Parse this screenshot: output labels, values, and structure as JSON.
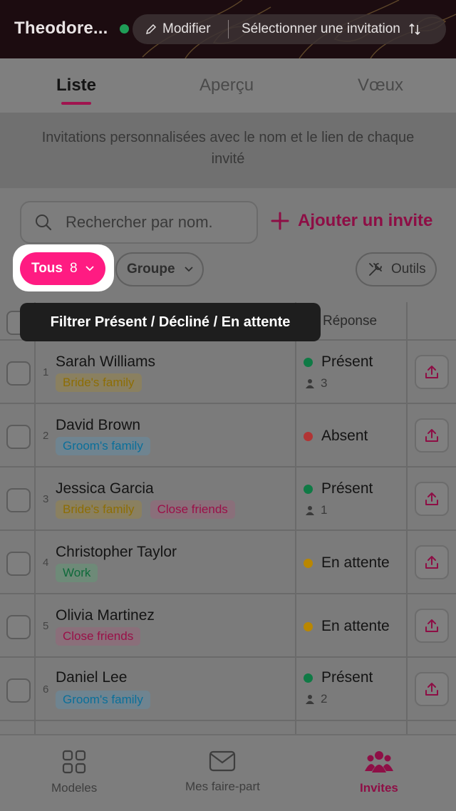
{
  "header": {
    "title": "Theodore...",
    "edit_label": "Modifier",
    "select_label": "Sélectionner une invitation"
  },
  "tabs": [
    {
      "label": "Liste",
      "active": true
    },
    {
      "label": "Aperçu",
      "active": false
    },
    {
      "label": "Vœux",
      "active": false
    }
  ],
  "info_text": "Invitations personnalisées avec le nom et le lien de chaque invité",
  "toolbar": {
    "search_placeholder": "Rechercher par nom.",
    "add_label": "Ajouter un invite",
    "filter_label": "Tous",
    "filter_count": "8",
    "group_label": "Groupe",
    "tools_label": "Outils"
  },
  "tooltip": "Filtrer Présent / Décliné / En attente",
  "table": {
    "header_response": "Réponse",
    "rows": [
      {
        "num": "1",
        "name": "Sarah Williams",
        "tags": [
          "Bride's family"
        ],
        "status": "Présent",
        "guests": "3"
      },
      {
        "num": "2",
        "name": "David Brown",
        "tags": [
          "Groom's family"
        ],
        "status": "Absent",
        "guests": ""
      },
      {
        "num": "3",
        "name": "Jessica Garcia",
        "tags": [
          "Bride's family",
          "Close friends"
        ],
        "status": "Présent",
        "guests": "1"
      },
      {
        "num": "4",
        "name": "Christopher Taylor",
        "tags": [
          "Work"
        ],
        "status": "En attente",
        "guests": ""
      },
      {
        "num": "5",
        "name": "Olivia Martinez",
        "tags": [
          "Close friends"
        ],
        "status": "En attente",
        "guests": ""
      },
      {
        "num": "6",
        "name": "Daniel Lee",
        "tags": [
          "Groom's family"
        ],
        "status": "Présent",
        "guests": "2"
      }
    ]
  },
  "bottom_nav": [
    {
      "label": "Modeles",
      "active": false
    },
    {
      "label": "Mes faire-part",
      "active": false
    },
    {
      "label": "Invites",
      "active": true
    }
  ],
  "colors": {
    "accent": "#ff1b82",
    "present": "#0f7a45",
    "absent": "#b13434",
    "pending": "#b98700"
  }
}
